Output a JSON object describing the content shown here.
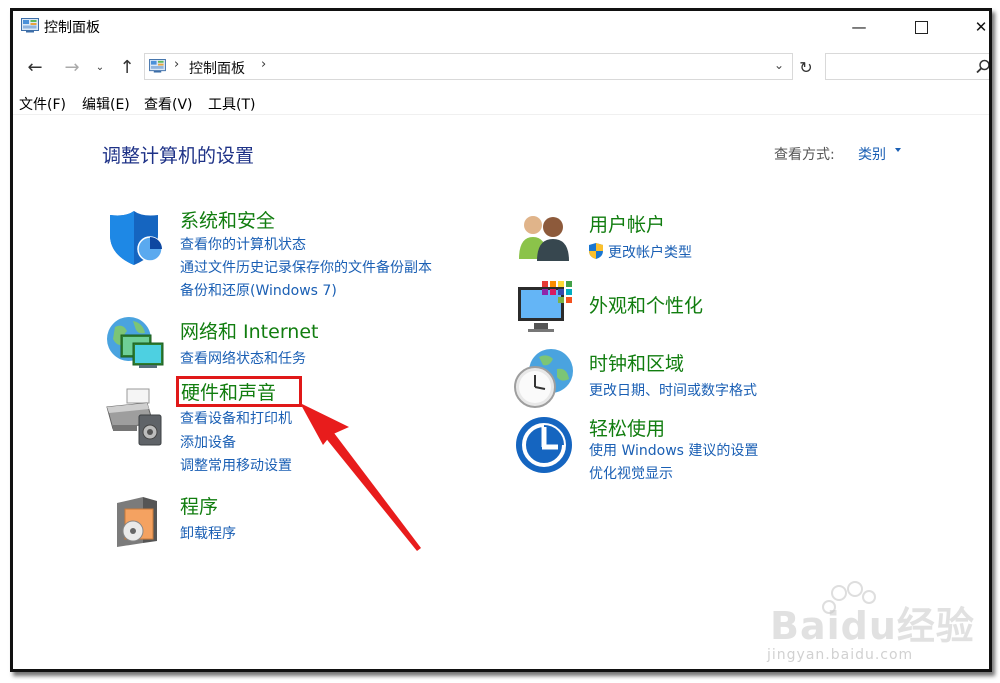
{
  "window": {
    "title": "控制面板",
    "controls": {
      "minimize": "—",
      "close": "✕"
    }
  },
  "navigation": {
    "back": "←",
    "forward": "→",
    "recent": "⌄",
    "up": "↑",
    "address_sep": "›",
    "address_text": "控制面板",
    "address_dropdown": "⌄",
    "refresh": "↻",
    "search_placeholder": ""
  },
  "menu": [
    {
      "label": "文件(F)"
    },
    {
      "label": "编辑(E)"
    },
    {
      "label": "查看(V)"
    },
    {
      "label": "工具(T)"
    }
  ],
  "content": {
    "heading": "调整计算机的设置",
    "view_by_label": "查看方式:",
    "view_by_value": "类别"
  },
  "categories_left": [
    {
      "title": "系统和安全",
      "links": [
        "查看你的计算机状态",
        "通过文件历史记录保存你的文件备份副本",
        "备份和还原(Windows 7)"
      ]
    },
    {
      "title": "网络和 Internet",
      "links": [
        "查看网络状态和任务"
      ]
    },
    {
      "title": "硬件和声音",
      "links": [
        "查看设备和打印机",
        "添加设备",
        "调整常用移动设置"
      ]
    },
    {
      "title": "程序",
      "links": [
        "卸载程序"
      ]
    }
  ],
  "categories_right": [
    {
      "title": "用户帐户",
      "links": [
        "更改帐户类型"
      ]
    },
    {
      "title": "外观和个性化",
      "links": []
    },
    {
      "title": "时钟和区域",
      "links": [
        "更改日期、时间或数字格式"
      ]
    },
    {
      "title": "轻松使用",
      "links": [
        "使用 Windows 建议的设置",
        "优化视觉显示"
      ]
    }
  ],
  "watermark": {
    "brand": "Baidu经验",
    "sub": "jingyan.baidu.com"
  },
  "colors": {
    "heading": "#1e3287",
    "category": "#117d0f",
    "link": "#1a5fb4",
    "highlight": "#e01818"
  }
}
